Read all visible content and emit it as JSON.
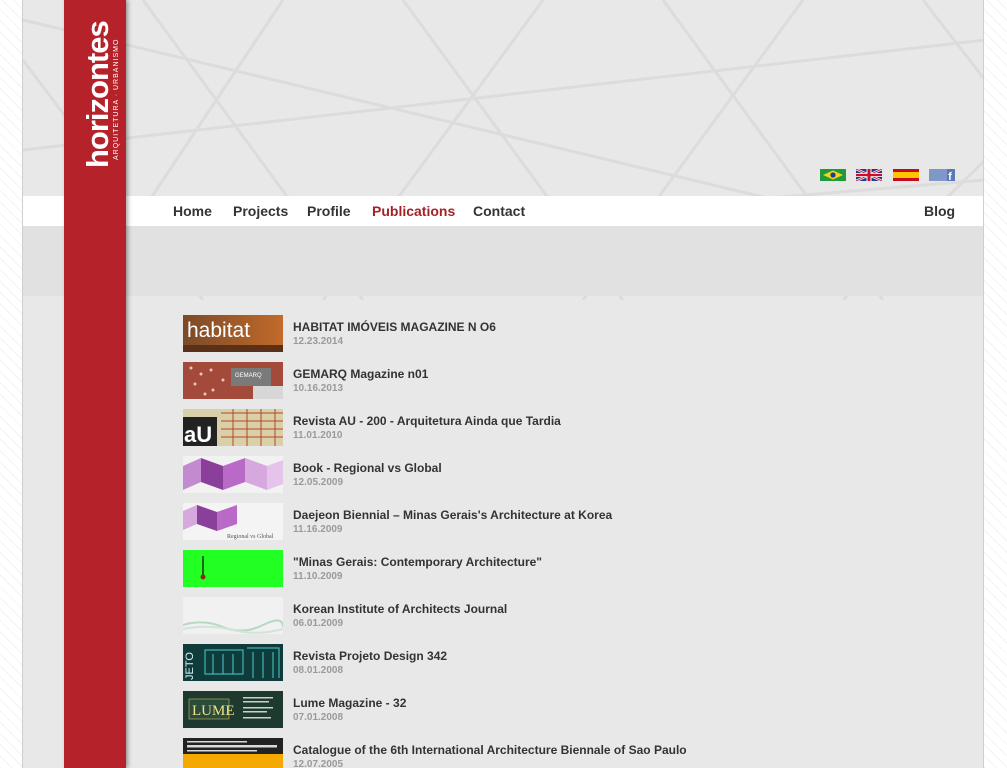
{
  "brand": {
    "name": "horizontes",
    "tagline": "ARQUITETURA · URBANISMO",
    "color": "#b6222a"
  },
  "languages": [
    {
      "name": "brazil-flag-icon"
    },
    {
      "name": "uk-flag-icon"
    },
    {
      "name": "spain-flag-icon"
    },
    {
      "name": "facebook-icon"
    }
  ],
  "nav": {
    "items": [
      {
        "label": "Home"
      },
      {
        "label": "Projects"
      },
      {
        "label": "Profile"
      },
      {
        "label": "Publications",
        "active": true
      },
      {
        "label": "Contact"
      }
    ],
    "blog": "Blog",
    "active_color": "#a5212a"
  },
  "publications": [
    {
      "title": "HABITAT IMÓVEIS MAGAZINE N O6",
      "date": "12.23.2014",
      "thumb_text": "habitat"
    },
    {
      "title": "GEMARQ Magazine n01",
      "date": "10.16.2013",
      "thumb_text": "GEMARQ"
    },
    {
      "title": "Revista AU - 200 - Arquitetura Ainda que Tardia",
      "date": "11.01.2010",
      "thumb_text": "aU"
    },
    {
      "title": "Book - Regional vs Global",
      "date": "12.05.2009",
      "thumb_text": ""
    },
    {
      "title": "Daejeon Biennial – Minas Gerais's Architecture at Korea",
      "date": "11.16.2009",
      "thumb_text": "Regional vs Global"
    },
    {
      "title": "\"Minas Gerais: Contemporary Architecture\"",
      "date": "11.10.2009",
      "thumb_text": ""
    },
    {
      "title": "Korean Institute of Architects Journal",
      "date": "06.01.2009",
      "thumb_text": ""
    },
    {
      "title": "Revista Projeto Design 342",
      "date": "08.01.2008",
      "thumb_text": "JETO"
    },
    {
      "title": "Lume Magazine - 32",
      "date": "07.01.2008",
      "thumb_text": "LUME"
    },
    {
      "title": "Catalogue of the 6th International Architecture Biennale of Sao Paulo",
      "date": "12.07.2005",
      "thumb_text": ""
    }
  ]
}
